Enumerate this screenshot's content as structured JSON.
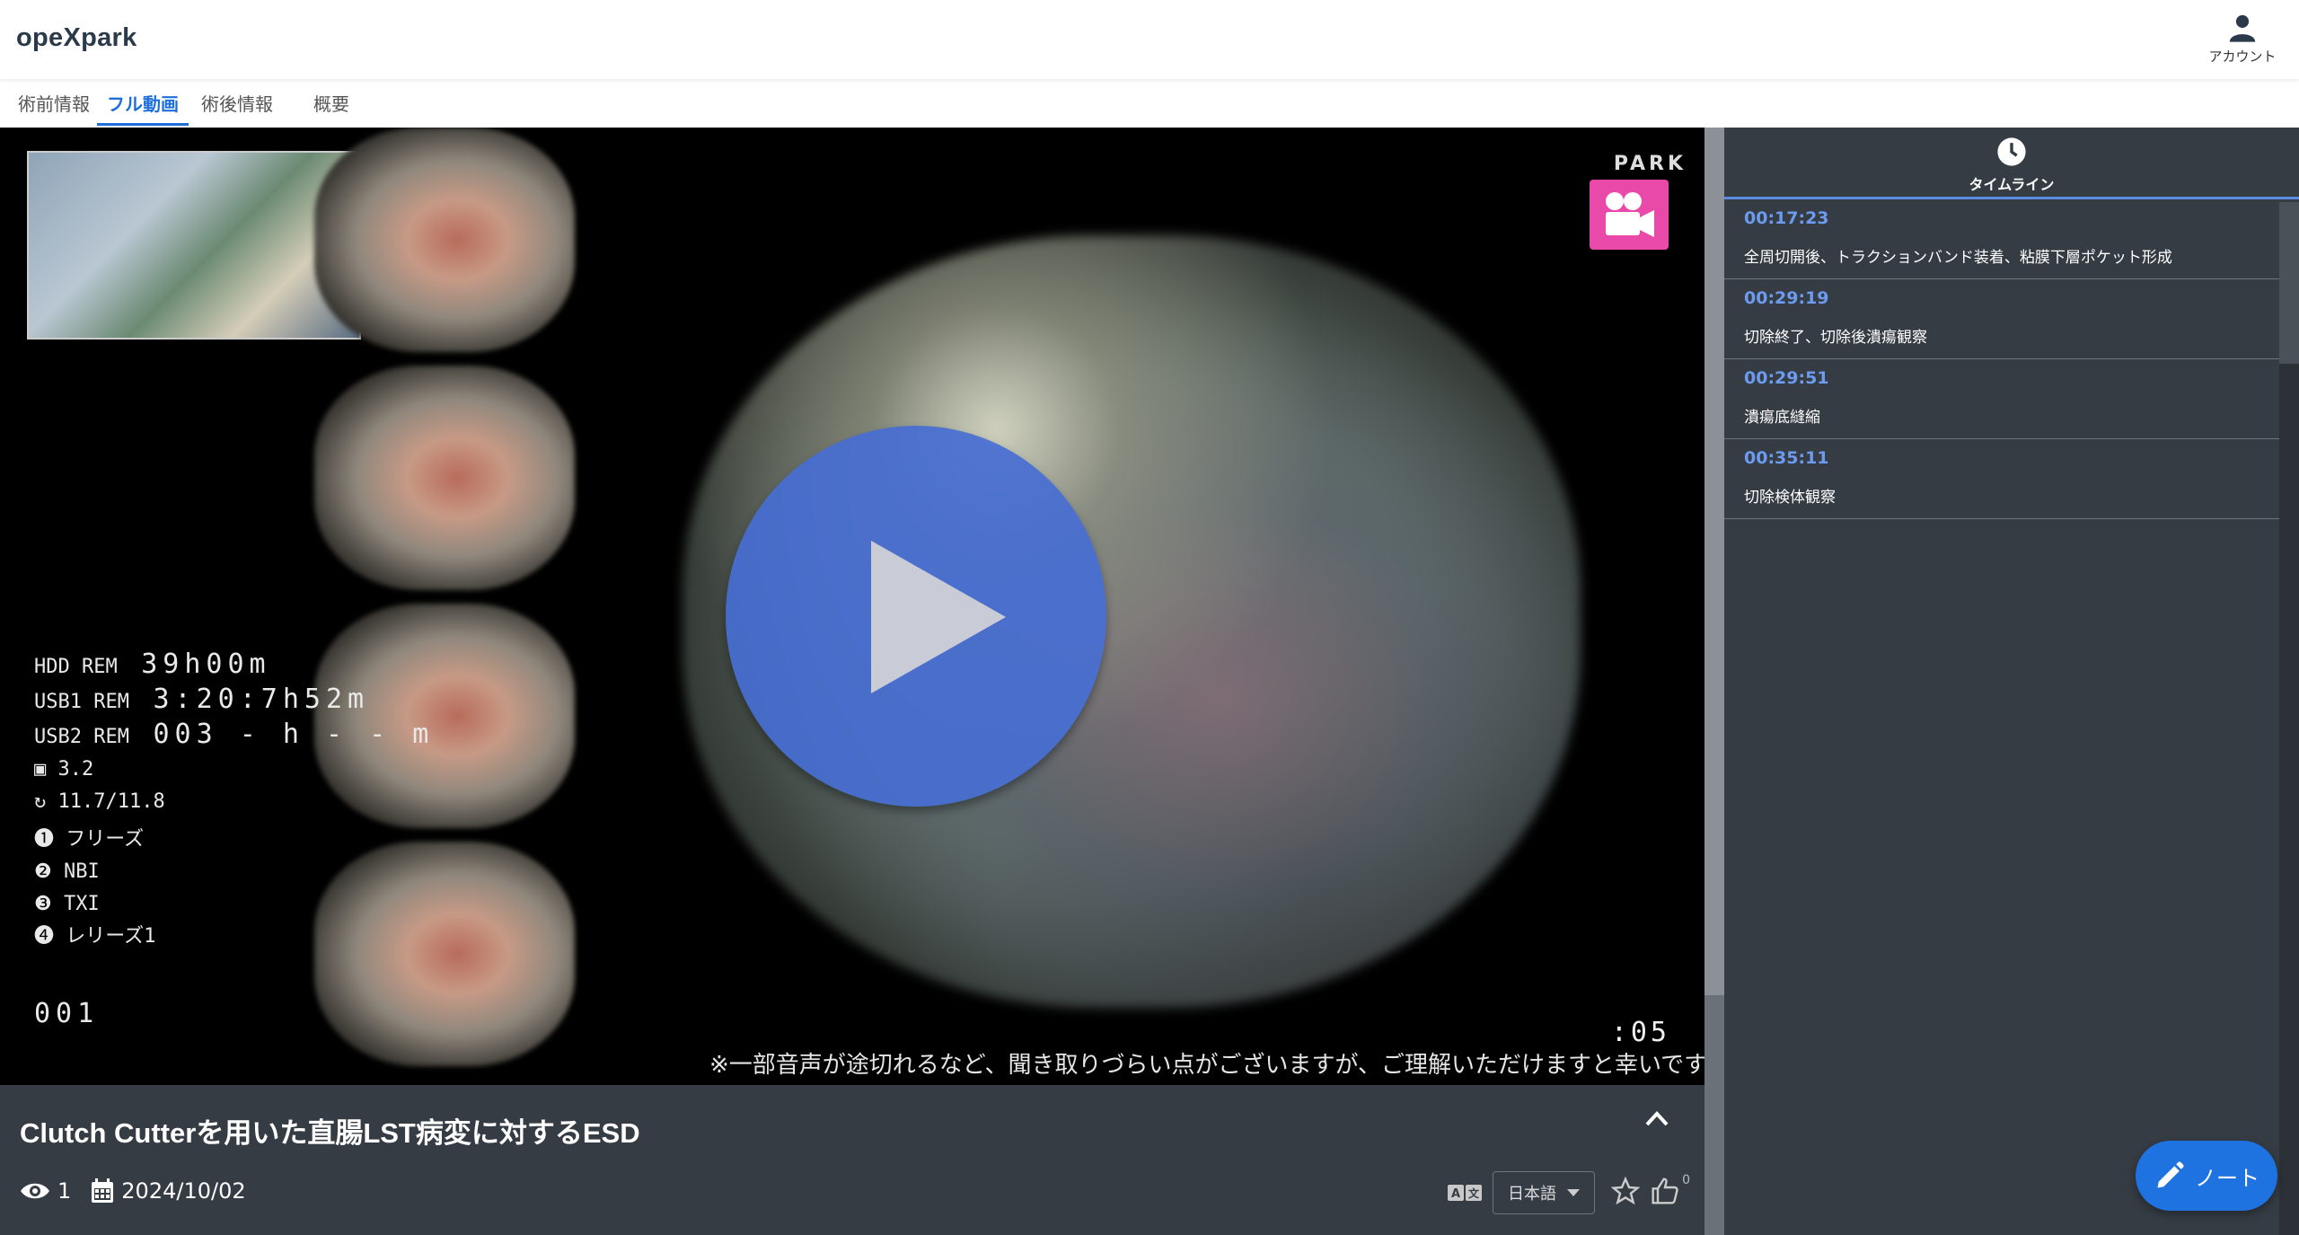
{
  "app": {
    "logo": "opeXpark",
    "account_label": "アカウント"
  },
  "tabs": [
    {
      "label": "術前情報",
      "active": false
    },
    {
      "label": "フル動画",
      "active": true
    },
    {
      "label": "術後情報",
      "active": false
    },
    {
      "label": "概要",
      "active": false
    }
  ],
  "video": {
    "watermark": "PARK",
    "hud": {
      "hdd": "HDD REM",
      "hdd_val": "39h00m",
      "usb1": "USB1 REM",
      "usb1_val": "3:20:7h52m",
      "usb2": "USB2 REM",
      "usb2_val": "003 - h - - m",
      "ch": "3.2",
      "ratio": "11.7/11.8",
      "modes": [
        "フリーズ",
        "NBI",
        "TXI",
        "レリーズ1"
      ],
      "counter": "001"
    },
    "time_corner": ":05",
    "subtitle": "※一部音声が途切れるなど、聞き取りづらい点がございますが、ご理解いただけますと幸いです。"
  },
  "info": {
    "title": "Clutch Cutterを用いた直腸LST病変に対するESD",
    "views": "1",
    "date": "2024/10/02",
    "language": "日本語",
    "likes": "0"
  },
  "timeline": {
    "header": "タイムライン",
    "items": [
      {
        "time": "00:17:23",
        "text": "全周切開後、トラクションバンド装着、粘膜下層ポケット形成"
      },
      {
        "time": "00:29:19",
        "text": "切除終了、切除後潰瘍観察"
      },
      {
        "time": "00:29:51",
        "text": "潰瘍底縫縮"
      },
      {
        "time": "00:35:11",
        "text": "切除検体観察"
      }
    ]
  },
  "note_button": "ノート",
  "colors": {
    "accent": "#1e6fd9",
    "panel": "#353c44",
    "timestamp": "#6d9bf0",
    "play": "#466ed2"
  }
}
